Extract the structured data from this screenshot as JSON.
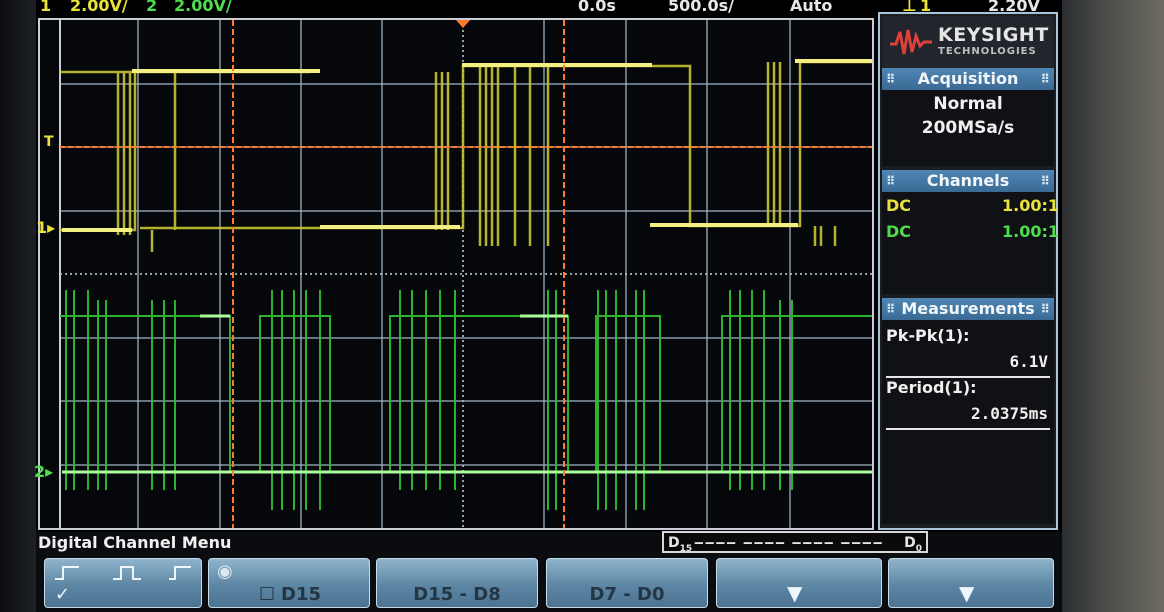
{
  "top_status": {
    "ch1_num": "1",
    "ch1_scale": "2.00V/",
    "ch2_num": "2",
    "ch2_scale": "2.00V/",
    "time_offset": "0.0s",
    "time_scale": "500.0s/",
    "trigger_mode": "Auto",
    "trigger_level": "2.20V"
  },
  "panel": {
    "brand": "KEYSIGHT",
    "brand_sub": "TECHNOLOGIES",
    "acquisition": {
      "title": "Acquisition",
      "mode": "Normal",
      "sample_rate": "200MSa/s"
    },
    "channels": {
      "title": "Channels",
      "rows": [
        {
          "coupling": "DC",
          "probe": "1.00:1",
          "color": "#e9e23a"
        },
        {
          "coupling": "DC",
          "probe": "1.00:1",
          "color": "#4fdc4f"
        }
      ]
    },
    "measurements": {
      "title": "Measurements",
      "items": [
        {
          "label": "Pk-Pk(1):",
          "value": "6.1V"
        },
        {
          "label": "Period(1):",
          "value": "2.0375ms"
        }
      ]
    }
  },
  "markers": {
    "trigger": "T",
    "ch1": "1",
    "ch2": "2"
  },
  "menu": {
    "title": "Digital Channel Menu",
    "bus": {
      "left": "D",
      "left_sub": "15",
      "right": "D",
      "right_sub": "0"
    },
    "softkeys": [
      {
        "name": "threshold",
        "label": ""
      },
      {
        "name": "channel",
        "label": "D15"
      },
      {
        "name": "d15-d8",
        "label": "D15 - D8"
      },
      {
        "name": "d7-d0",
        "label": "D7 - D0"
      },
      {
        "name": "more-1",
        "label": ""
      },
      {
        "name": "more-2",
        "label": ""
      }
    ]
  },
  "colors": {
    "ch1": "#e9e23a",
    "ch2": "#4fdc4f",
    "cursor": "#ff7a2a",
    "grid": "#c9ced6",
    "panel_head": "#4f86b4"
  }
}
